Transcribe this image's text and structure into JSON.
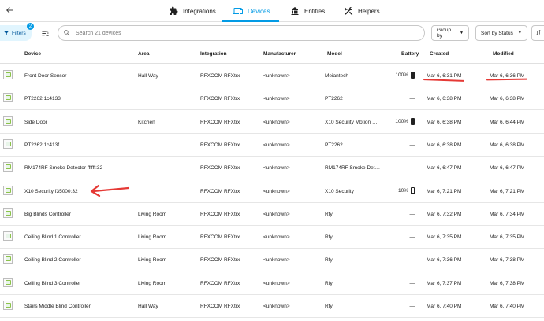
{
  "colors": {
    "accent": "#039be5",
    "annotation": "#e53935"
  },
  "nav": {
    "back_icon": "arrow-left-icon",
    "tabs": [
      {
        "label": "Integrations",
        "icon": "puzzle-icon",
        "active": false
      },
      {
        "label": "Devices",
        "icon": "devices-icon",
        "active": true
      },
      {
        "label": "Entities",
        "icon": "entities-icon",
        "active": false
      },
      {
        "label": "Helpers",
        "icon": "tools-icon",
        "active": false
      }
    ]
  },
  "toolbar": {
    "filters_label": "Filters",
    "filters_count": "2",
    "search_placeholder": "Search 21 devices",
    "group_by_label": "Group by",
    "sort_label": "Sort by Status"
  },
  "table": {
    "headers": {
      "device": "Device",
      "area": "Area",
      "integration": "Integration",
      "manufacturer": "Manufacturer",
      "model": "Model",
      "battery": "Battery",
      "created": "Created",
      "modified": "Modified"
    },
    "rows": [
      {
        "device": "Front Door Sensor",
        "area": "Hall Way",
        "integration": "RFXCOM RFXtrx",
        "manufacturer": "<unknown>",
        "model": "Meiantech",
        "battery": "100%",
        "battery_level": 100,
        "created": "Mar 6, 6:31 PM",
        "modified": "Mar 6, 6:36 PM"
      },
      {
        "device": "PT2262 1c4133",
        "area": "",
        "integration": "RFXCOM RFXtrx",
        "manufacturer": "<unknown>",
        "model": "PT2262",
        "battery": "—",
        "battery_level": null,
        "created": "Mar 6, 6:38 PM",
        "modified": "Mar 6, 6:38 PM"
      },
      {
        "device": "Side Door",
        "area": "Kitchen",
        "integration": "RFXCOM RFXtrx",
        "manufacturer": "<unknown>",
        "model": "X10 Security Motion …",
        "battery": "100%",
        "battery_level": 100,
        "created": "Mar 6, 6:38 PM",
        "modified": "Mar 6, 6:44 PM"
      },
      {
        "device": "PT2262 1c413f",
        "area": "",
        "integration": "RFXCOM RFXtrx",
        "manufacturer": "<unknown>",
        "model": "PT2262",
        "battery": "—",
        "battery_level": null,
        "created": "Mar 6, 6:38 PM",
        "modified": "Mar 6, 6:38 PM"
      },
      {
        "device": "RM174RF Smoke Detector ffffff:32",
        "area": "",
        "integration": "RFXCOM RFXtrx",
        "manufacturer": "<unknown>",
        "model": "RM174RF Smoke Det…",
        "battery": "—",
        "battery_level": null,
        "created": "Mar 6, 6:47 PM",
        "modified": "Mar 6, 6:47 PM"
      },
      {
        "device": "X10 Security f35000:32",
        "area": "",
        "integration": "RFXCOM RFXtrx",
        "manufacturer": "<unknown>",
        "model": "X10 Security",
        "battery": "10%",
        "battery_level": 10,
        "created": "Mar 6, 7:21 PM",
        "modified": "Mar 6, 7:21 PM"
      },
      {
        "device": "Big Blinds Controller",
        "area": "Living Room",
        "integration": "RFXCOM RFXtrx",
        "manufacturer": "<unknown>",
        "model": "Rfy",
        "battery": "—",
        "battery_level": null,
        "created": "Mar 6, 7:32 PM",
        "modified": "Mar 6, 7:34 PM"
      },
      {
        "device": "Ceiling Blind 1 Controller",
        "area": "Living Room",
        "integration": "RFXCOM RFXtrx",
        "manufacturer": "<unknown>",
        "model": "Rfy",
        "battery": "—",
        "battery_level": null,
        "created": "Mar 6, 7:35 PM",
        "modified": "Mar 6, 7:35 PM"
      },
      {
        "device": "Ceiling Blind 2 Controller",
        "area": "Living Room",
        "integration": "RFXCOM RFXtrx",
        "manufacturer": "<unknown>",
        "model": "Rfy",
        "battery": "—",
        "battery_level": null,
        "created": "Mar 6, 7:36 PM",
        "modified": "Mar 6, 7:38 PM"
      },
      {
        "device": "Ceiling Blind 3 Controller",
        "area": "Living Room",
        "integration": "RFXCOM RFXtrx",
        "manufacturer": "<unknown>",
        "model": "Rfy",
        "battery": "—",
        "battery_level": null,
        "created": "Mar 6, 7:37 PM",
        "modified": "Mar 6, 7:38 PM"
      },
      {
        "device": "Stairs Middle Blind Controller",
        "area": "Hall Way",
        "integration": "RFXCOM RFXtrx",
        "manufacturer": "<unknown>",
        "model": "Rfy",
        "battery": "—",
        "battery_level": null,
        "created": "Mar 6, 7:40 PM",
        "modified": "Mar 6, 7:40 PM"
      }
    ]
  }
}
